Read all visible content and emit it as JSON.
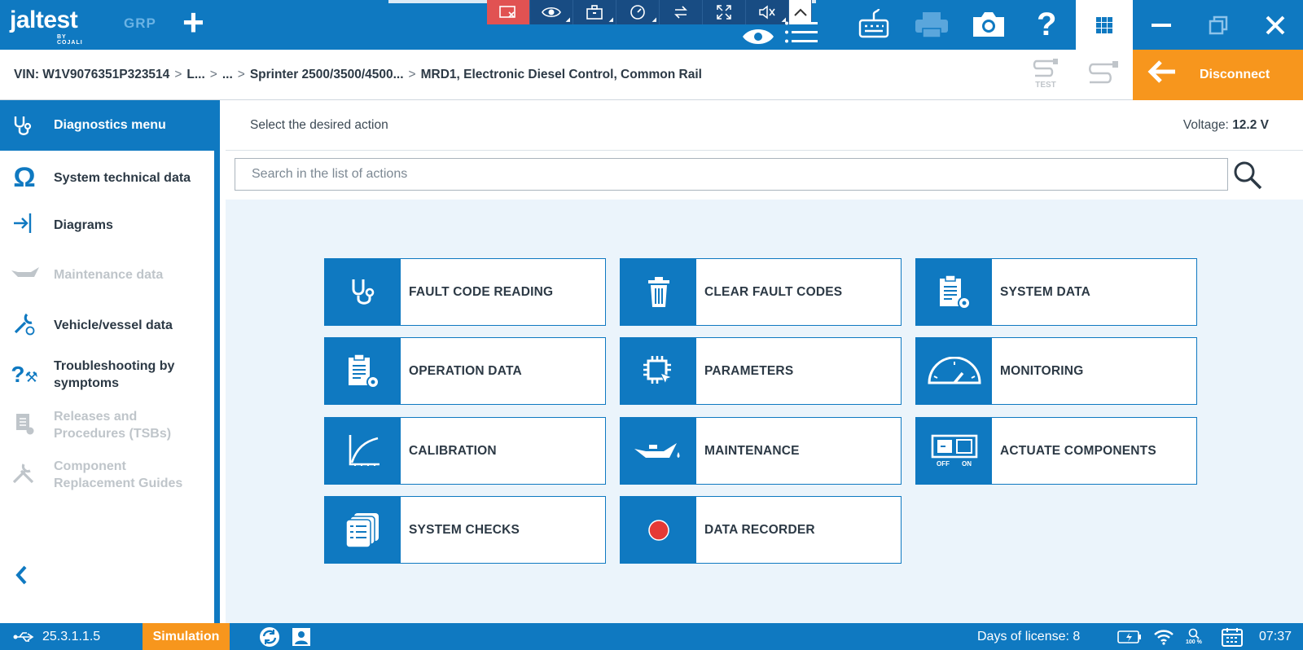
{
  "app": {
    "logo": "jaltest",
    "logo_by": "BY COJALI",
    "grp_label": "GRP",
    "add_label": "+"
  },
  "remote_toolbar": {
    "icons": [
      "screen-share-off-icon",
      "eye-icon",
      "toolbox-icon",
      "speed-dial-icon",
      "transfer-icon",
      "fullscreen-icon",
      "mute-icon",
      "chevron-up-icon"
    ]
  },
  "breadcrumb": {
    "vin": "VIN: W1V9076351P323514",
    "items": [
      "L...",
      "...",
      "Sprinter 2500/3500/4500...",
      "MRD1, Electronic Diesel Control, Common Rail"
    ]
  },
  "header_right": {
    "test_label": "TEST",
    "disconnect_label": "Disconnect"
  },
  "sidebar": {
    "header": "Diagnostics menu",
    "items": [
      {
        "label": "System technical data",
        "icon": "omega-icon",
        "enabled": true
      },
      {
        "label": "Diagrams",
        "icon": "diagram-icon",
        "enabled": true
      },
      {
        "label": "Maintenance data",
        "icon": "oil-can-icon",
        "enabled": false
      },
      {
        "label": "Vehicle/vessel data",
        "icon": "wrench-globe-icon",
        "enabled": true
      },
      {
        "label": "Troubleshooting by symptoms",
        "icon": "troubleshoot-icon",
        "enabled": true
      },
      {
        "label": "Releases and Procedures (TSBs)",
        "icon": "releases-icon",
        "enabled": false
      },
      {
        "label": "Component Replacement Guides",
        "icon": "tools-icon",
        "enabled": false
      }
    ],
    "collapse_label": "<"
  },
  "main": {
    "hint": "Select the desired action",
    "voltage_label": "Voltage:",
    "voltage_value": "12.2 V",
    "search_placeholder": "Search in the list of actions",
    "actions": [
      {
        "label": "FAULT CODE READING",
        "icon": "stethoscope-icon"
      },
      {
        "label": "CLEAR FAULT CODES",
        "icon": "trash-icon"
      },
      {
        "label": "SYSTEM DATA",
        "icon": "clipboard-gear-icon"
      },
      {
        "label": "OPERATION DATA",
        "icon": "clipboard-gear-icon"
      },
      {
        "label": "PARAMETERS",
        "icon": "chip-cursor-icon"
      },
      {
        "label": "MONITORING",
        "icon": "gauge-icon"
      },
      {
        "label": "CALIBRATION",
        "icon": "curve-graph-icon"
      },
      {
        "label": "MAINTENANCE",
        "icon": "oil-can-icon"
      },
      {
        "label": "ACTUATE COMPONENTS",
        "icon": "switch-off-on-icon"
      },
      {
        "label": "SYSTEM CHECKS",
        "icon": "checklist-icon"
      },
      {
        "label": "DATA RECORDER",
        "icon": "record-icon"
      }
    ],
    "actuate_off": "OFF",
    "actuate_on": "ON"
  },
  "statusbar": {
    "version": "25.3.1.1.5",
    "mode": "Simulation",
    "license": "Days of license: 8",
    "zoom": "100 %",
    "time": "07:37"
  },
  "colors": {
    "brand_blue": "#0f79c1",
    "accent_orange": "#f7961d",
    "record_red": "#e53935"
  }
}
